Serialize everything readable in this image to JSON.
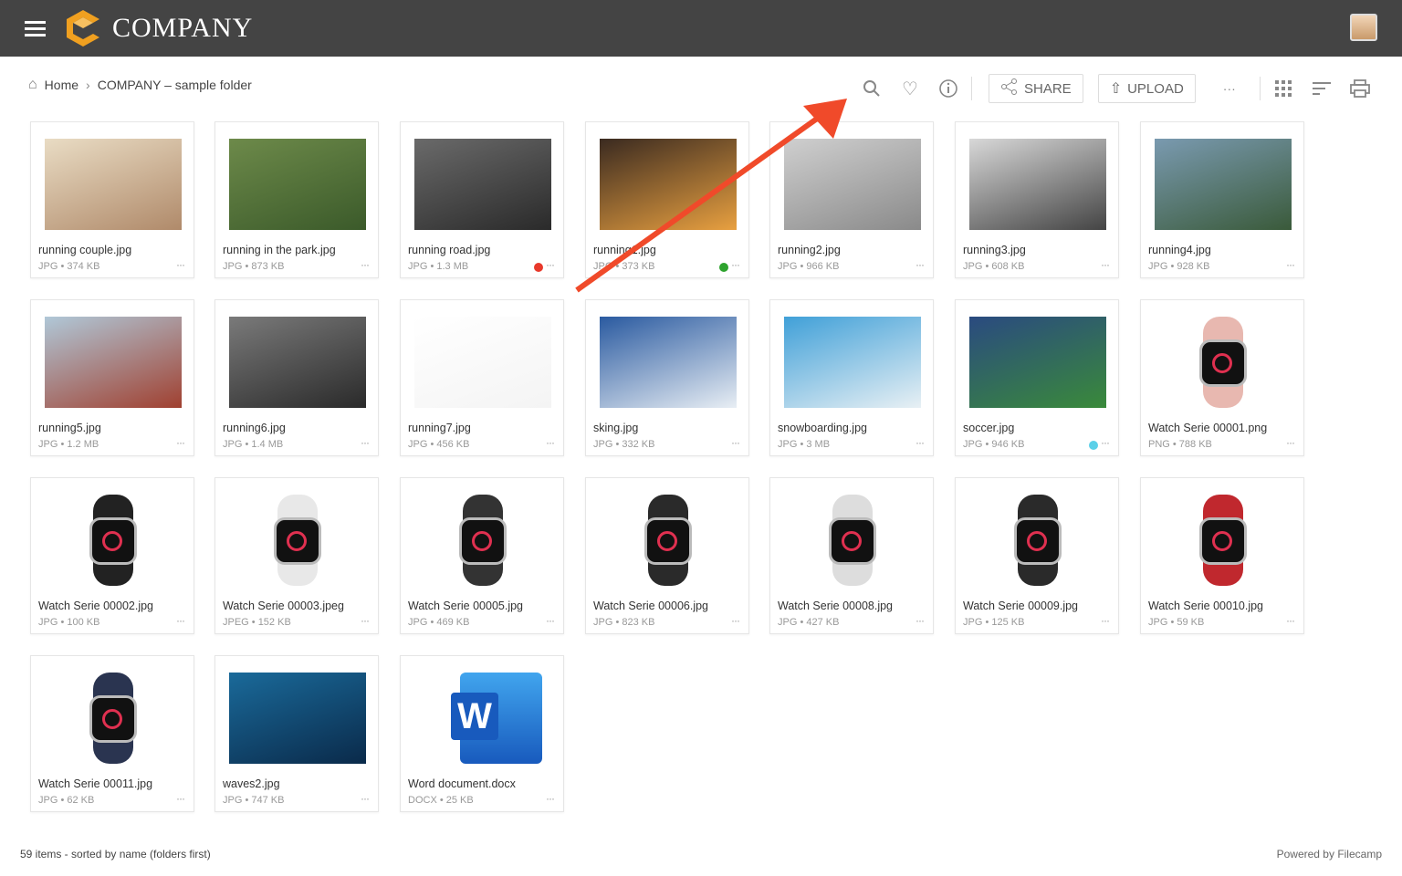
{
  "header": {
    "brand": "COMPANY",
    "menu_icon": "hamburger-icon",
    "logo": "company-logo",
    "avatar": "user-avatar"
  },
  "breadcrumb": {
    "home": "Home",
    "separator": "›",
    "folder": "COMPANY – sample folder"
  },
  "toolbar": {
    "share": "SHARE",
    "upload": "UPLOAD",
    "more": "···",
    "icons": [
      "search-icon",
      "heart-icon",
      "info-icon",
      "share-icon",
      "upload-icon",
      "more-icon",
      "grid-view-icon",
      "sort-icon",
      "print-icon"
    ]
  },
  "files": [
    {
      "name": "running couple.jpg",
      "meta": "JPG • 374 KB",
      "thumb": [
        "#e9dcc4",
        "#b08a6a"
      ]
    },
    {
      "name": "running in the park.jpg",
      "meta": "JPG • 873 KB",
      "thumb": [
        "#6d8a4a",
        "#3b5a2a"
      ]
    },
    {
      "name": "running road.jpg",
      "meta": "JPG • 1.3 MB",
      "thumb": [
        "#6a6a6a",
        "#2a2a2a"
      ],
      "tag": "#e8392b"
    },
    {
      "name": "running1.jpg",
      "meta": "JPG • 373 KB",
      "thumb": [
        "#3a2a20",
        "#e8a040"
      ],
      "tag": "#2ea32e"
    },
    {
      "name": "running2.jpg",
      "meta": "JPG • 966 KB",
      "thumb": [
        "#cfcfcf",
        "#8a8a8a"
      ]
    },
    {
      "name": "running3.jpg",
      "meta": "JPG • 608 KB",
      "thumb": [
        "#d8d8d8",
        "#444"
      ]
    },
    {
      "name": "running4.jpg",
      "meta": "JPG • 928 KB",
      "thumb": [
        "#7a9ab0",
        "#3a5a3a"
      ]
    },
    {
      "name": "running5.jpg",
      "meta": "JPG • 1.2 MB",
      "thumb": [
        "#b0c8d8",
        "#a04030"
      ]
    },
    {
      "name": "running6.jpg",
      "meta": "JPG • 1.4 MB",
      "thumb": [
        "#7a7a7a",
        "#2a2a2a"
      ]
    },
    {
      "name": "running7.jpg",
      "meta": "JPG • 456 KB",
      "thumb": [
        "#ffffff",
        "#f4f4f4"
      ]
    },
    {
      "name": "sking.jpg",
      "meta": "JPG • 332 KB",
      "thumb": [
        "#2a5aa0",
        "#e8eef4"
      ]
    },
    {
      "name": "snowboarding.jpg",
      "meta": "JPG • 3 MB",
      "thumb": [
        "#40a0d8",
        "#e8f0f4"
      ]
    },
    {
      "name": "soccer.jpg",
      "meta": "JPG • 946 KB",
      "thumb": [
        "#2a4a80",
        "#3a8a3a"
      ],
      "tag": "#5bd0e8"
    },
    {
      "name": "Watch Serie 00001.png",
      "meta": "PNG • 788 KB",
      "thumb": [
        "#fff",
        "#fff"
      ],
      "watch": "#e8b8b0"
    },
    {
      "name": "Watch Serie 00002.jpg",
      "meta": "JPG • 100 KB",
      "thumb": [
        "#fff",
        "#fff"
      ],
      "watch": "#222"
    },
    {
      "name": "Watch Serie 00003.jpeg",
      "meta": "JPEG • 152 KB",
      "thumb": [
        "#fff",
        "#fff"
      ],
      "watch": "#e8e8e8"
    },
    {
      "name": "Watch Serie 00005.jpg",
      "meta": "JPG • 469 KB",
      "thumb": [
        "#fff",
        "#fff"
      ],
      "watch": "#333"
    },
    {
      "name": "Watch Serie 00006.jpg",
      "meta": "JPG • 823 KB",
      "thumb": [
        "#fff",
        "#fff"
      ],
      "watch": "#2a2a2a"
    },
    {
      "name": "Watch Serie 00008.jpg",
      "meta": "JPG • 427 KB",
      "thumb": [
        "#fff",
        "#fff"
      ],
      "watch": "#ddd"
    },
    {
      "name": "Watch Serie 00009.jpg",
      "meta": "JPG • 125 KB",
      "thumb": [
        "#fff",
        "#fff"
      ],
      "watch": "#2a2a2a"
    },
    {
      "name": "Watch Serie 00010.jpg",
      "meta": "JPG • 59 KB",
      "thumb": [
        "#fff",
        "#fff"
      ],
      "watch": "#c0282e"
    },
    {
      "name": "Watch Serie 00011.jpg",
      "meta": "JPG • 62 KB",
      "thumb": [
        "#fff",
        "#fff"
      ],
      "watch": "#2a3450"
    },
    {
      "name": "waves2.jpg",
      "meta": "JPG • 747 KB",
      "thumb": [
        "#1a6a9a",
        "#0a2a4a"
      ]
    },
    {
      "name": "Word document.docx",
      "meta": "DOCX • 25 KB",
      "thumb": [
        "#fff",
        "#fff"
      ],
      "word": "W"
    }
  ],
  "footer": {
    "status": "59 items - sorted by name (folders first)",
    "powered": "Powered by Filecamp"
  },
  "annotation": {
    "arrow_color": "#f04a2a"
  }
}
